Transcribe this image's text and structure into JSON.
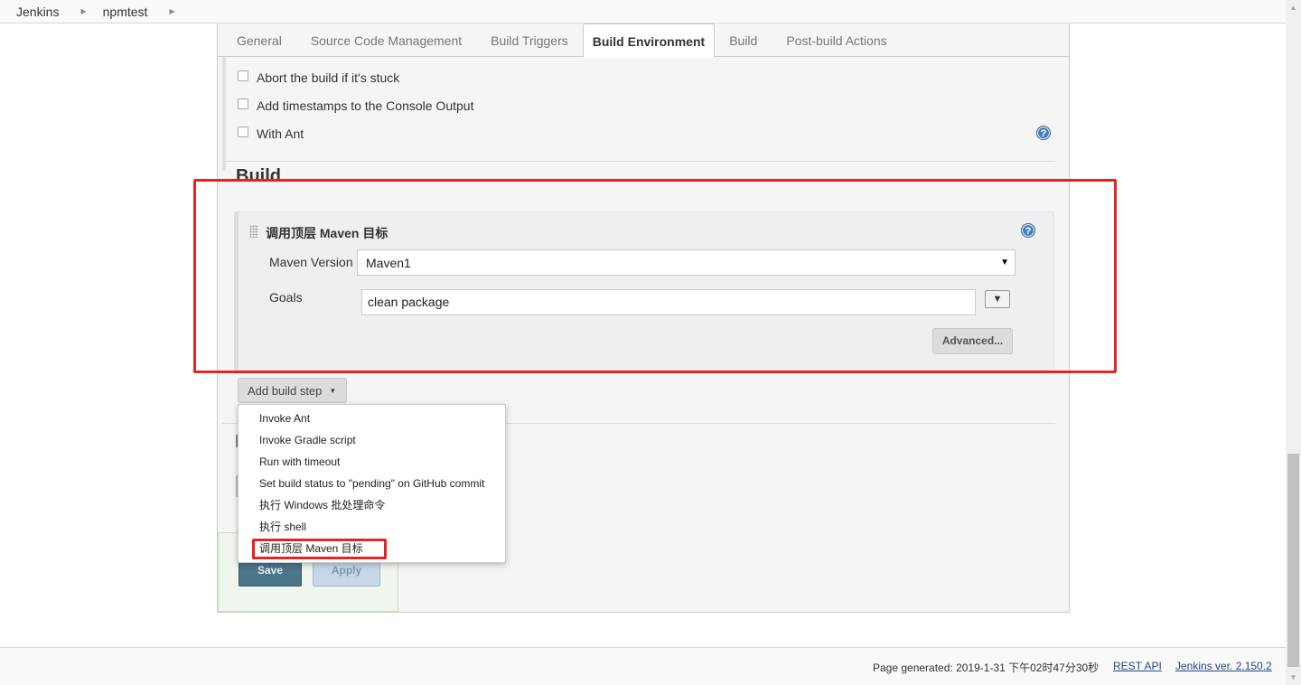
{
  "breadcrumb": {
    "items": [
      "Jenkins",
      "npmtest"
    ]
  },
  "tabs": {
    "items": [
      "General",
      "Source Code Management",
      "Build Triggers",
      "Build Environment",
      "Build",
      "Post-build Actions"
    ],
    "active": "Build Environment"
  },
  "build_environment": {
    "options": [
      {
        "label": "Abort the build if it's stuck",
        "checked": false
      },
      {
        "label": "Add timestamps to the Console Output",
        "checked": false
      },
      {
        "label": "With Ant",
        "checked": false
      }
    ]
  },
  "build": {
    "section_title": "Build",
    "step": {
      "title": "调用顶层 Maven 目标",
      "maven_version_label": "Maven Version",
      "maven_version_value": "Maven1",
      "goals_label": "Goals",
      "goals_value": "clean package",
      "advanced_label": "Advanced..."
    },
    "add_step_label": "Add build step"
  },
  "add_step_menu": {
    "items": [
      "Invoke Ant",
      "Invoke Gradle script",
      "Run with timeout",
      "Set build status to \"pending\" on GitHub commit",
      "执行 Windows 批处理命令",
      "执行 shell",
      "调用顶层 Maven 目标"
    ]
  },
  "actions": {
    "save_label": "Save",
    "apply_label": "Apply"
  },
  "footer": {
    "generated": "Page generated: 2019-1-31 下午02时47分30秒",
    "rest_api": "REST API",
    "version": "Jenkins ver. 2.150.2"
  },
  "colors": {
    "annotation": "#e22424",
    "save_button": "#4b758b",
    "help_icon": "#4a7ec4"
  }
}
